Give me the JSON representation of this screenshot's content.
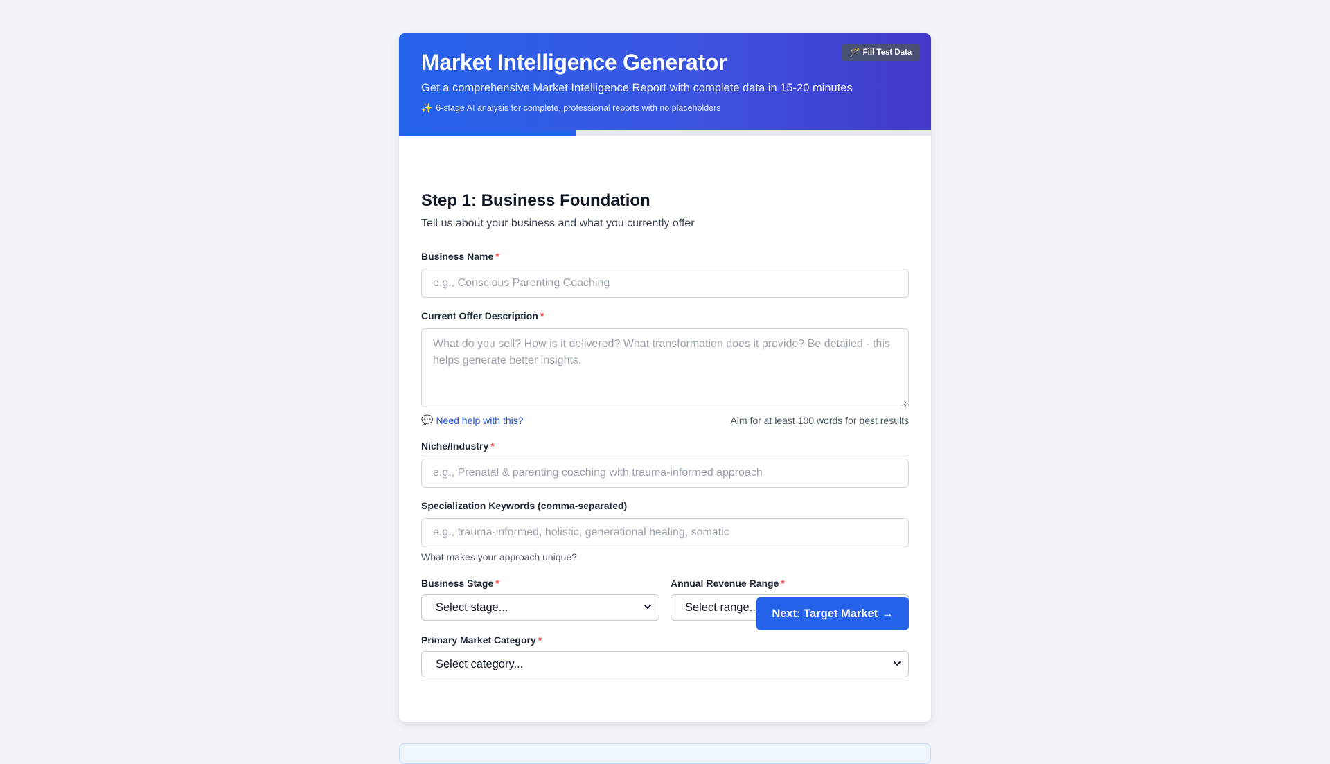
{
  "header": {
    "title": "Market Intelligence Generator",
    "subtitle": "Get a comprehensive Market Intelligence Report with complete data in 15-20 minutes",
    "note_icon": "✨",
    "note": "6-stage AI analysis for complete, professional reports with no placeholders",
    "fill_button_icon": "🪄",
    "fill_button_label": "Fill Test Data",
    "progress_fraction": 0.333
  },
  "step": {
    "title": "Step 1: Business Foundation",
    "subtitle": "Tell us about your business and what you currently offer"
  },
  "fields": {
    "business_name": {
      "label": "Business Name",
      "required": "*",
      "value": "",
      "placeholder": "e.g., Conscious Parenting Coaching"
    },
    "offer_description": {
      "label": "Current Offer Description",
      "required": "*",
      "value": "",
      "placeholder": "What do you sell? How is it delivered? What transformation does it provide? Be detailed - this helps generate better insights.",
      "help_icon": "💬",
      "help_link": "Need help with this?",
      "word_hint": "Aim for at least 100 words for best results"
    },
    "niche": {
      "label": "Niche/Industry",
      "required": "*",
      "value": "",
      "placeholder": "e.g., Prenatal & parenting coaching with trauma-informed approach"
    },
    "keywords": {
      "label": "Specialization Keywords (comma-separated)",
      "value": "",
      "placeholder": "e.g., trauma-informed, holistic, generational healing, somatic",
      "hint": "What makes your approach unique?"
    },
    "business_stage": {
      "label": "Business Stage",
      "required": "*",
      "selected": "Select stage..."
    },
    "revenue_range": {
      "label": "Annual Revenue Range",
      "required": "*",
      "selected": "Select range..."
    },
    "market_category": {
      "label": "Primary Market Category",
      "required": "*",
      "selected": "Select category..."
    }
  },
  "actions": {
    "next_label": "Next: Target Market",
    "next_arrow": "→"
  },
  "icons": {
    "sparkle": "sparkle-icon",
    "wand": "magic-wand-icon",
    "chat": "chat-bubble-icon",
    "chevron": "chevron-down-icon",
    "chevron_glyph": "⌄"
  },
  "colors": {
    "header_start": "#2563eb",
    "header_end": "#4338ca",
    "accent": "#2563eb",
    "required": "#ef4444",
    "link": "#1d4ed8"
  }
}
